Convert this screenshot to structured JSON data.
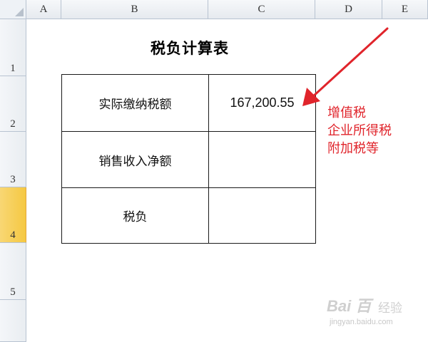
{
  "columns": [
    "A",
    "B",
    "C",
    "D",
    "E"
  ],
  "rows": [
    "1",
    "2",
    "3",
    "4",
    "5"
  ],
  "selected_row": "4",
  "title": "税负计算表",
  "table": {
    "labels": [
      "实际缴纳税额",
      "销售收入净额",
      "税负"
    ],
    "values": [
      "167,200.55",
      "",
      ""
    ]
  },
  "annotation": {
    "lines": [
      "增值税",
      "企业所得税",
      "附加税等"
    ],
    "color": "#e0242b"
  },
  "watermark": {
    "logo": "Bai 百",
    "sub": "经验",
    "url": "jingyan.baidu.com"
  },
  "colors": {
    "header_bg": "#e6eaef",
    "selected_row_header": "#f5c842",
    "grid_border": "#1a1a1a"
  }
}
